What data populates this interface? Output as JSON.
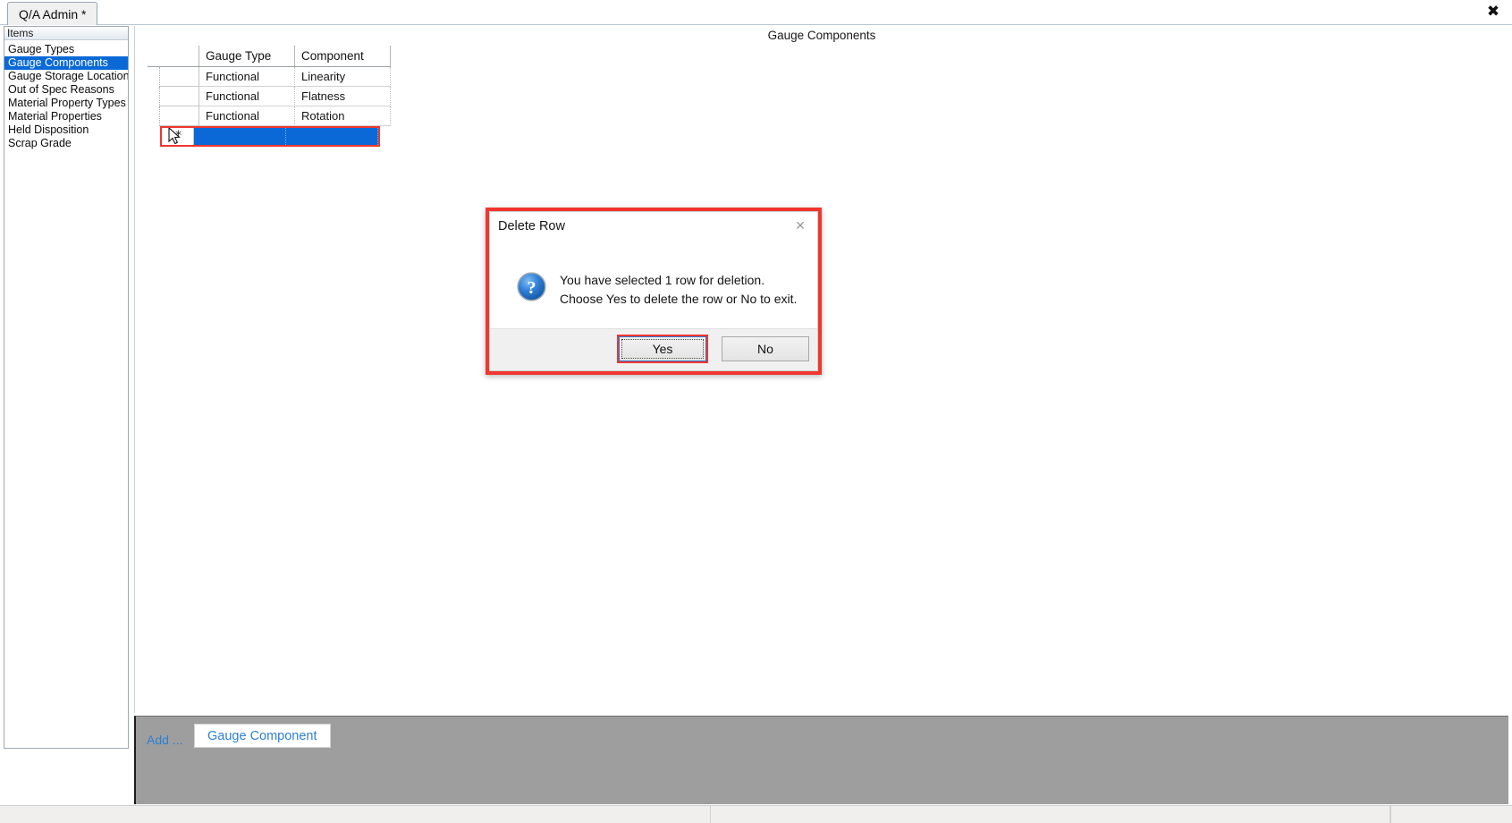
{
  "window": {
    "tab_label": "Q/A Admin *",
    "close_icon": "close-icon"
  },
  "sidebar": {
    "header": "Items",
    "items": [
      {
        "label": "Gauge Types",
        "selected": false
      },
      {
        "label": "Gauge Components",
        "selected": true
      },
      {
        "label": "Gauge Storage Locations",
        "selected": false
      },
      {
        "label": "Out of Spec Reasons",
        "selected": false
      },
      {
        "label": "Material Property Types",
        "selected": false
      },
      {
        "label": "Material Properties",
        "selected": false
      },
      {
        "label": "Held Disposition",
        "selected": false
      },
      {
        "label": "Scrap Grade",
        "selected": false
      }
    ]
  },
  "content": {
    "title": "Gauge Components",
    "grid": {
      "columns": [
        "Gauge Type",
        "Component"
      ],
      "rows": [
        [
          "Functional",
          "Linearity"
        ],
        [
          "Functional",
          "Flatness"
        ],
        [
          "Functional",
          "Rotation"
        ]
      ],
      "new_row_marker": "*"
    }
  },
  "toolbar": {
    "add_label": "Add ...",
    "add_button_label": "Gauge Component"
  },
  "dialog": {
    "title": "Delete Row",
    "close_icon": "close-icon",
    "question_icon": "question-icon",
    "message_line1": "You have selected 1 row for deletion.",
    "message_line2": "Choose Yes to delete the row or No to exit.",
    "yes_label": "Yes",
    "no_label": "No"
  },
  "colors": {
    "highlight_red": "#f0362e",
    "selection_blue": "#0a69d6",
    "link_blue": "#2d7fd3",
    "toolbar_gray": "#9e9e9e"
  }
}
